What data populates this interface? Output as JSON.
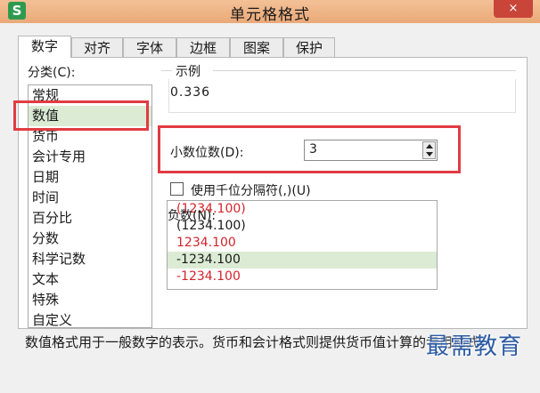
{
  "window": {
    "app_icon": "S",
    "title": "单元格格式",
    "close_icon": "×"
  },
  "tabs": [
    {
      "label": "数字",
      "active": true
    },
    {
      "label": "对齐"
    },
    {
      "label": "字体"
    },
    {
      "label": "边框"
    },
    {
      "label": "图案"
    },
    {
      "label": "保护"
    }
  ],
  "category": {
    "label": "分类(C):",
    "items": [
      "常规",
      "数值",
      "货币",
      "会计专用",
      "日期",
      "时间",
      "百分比",
      "分数",
      "科学记数",
      "文本",
      "特殊",
      "自定义"
    ],
    "selected_index": 1
  },
  "sample": {
    "label": "示例",
    "value": "0.336"
  },
  "decimals": {
    "label": "小数位数(D):",
    "value": "3"
  },
  "thousands": {
    "label": "使用千位分隔符(,)(U)",
    "checked": false
  },
  "negative": {
    "label": "负数(N):",
    "items": [
      {
        "text": "(1234.100)",
        "color": "#d4242b"
      },
      {
        "text": "(1234.100)",
        "color": "#1a1a1a"
      },
      {
        "text": "1234.100",
        "color": "#d4242b"
      },
      {
        "text": "-1234.100",
        "color": "#1a1a1a"
      },
      {
        "text": "-1234.100",
        "color": "#d4242b"
      }
    ],
    "selected_index": 3
  },
  "description": "数值格式用于一般数字的表示。货币和会计格式则提供货币值计算的专用格式。",
  "watermark": "最需教育",
  "colors": {
    "highlight": "#e23b43",
    "selection": "#dcebd4",
    "titlebar": "#eaa978"
  }
}
